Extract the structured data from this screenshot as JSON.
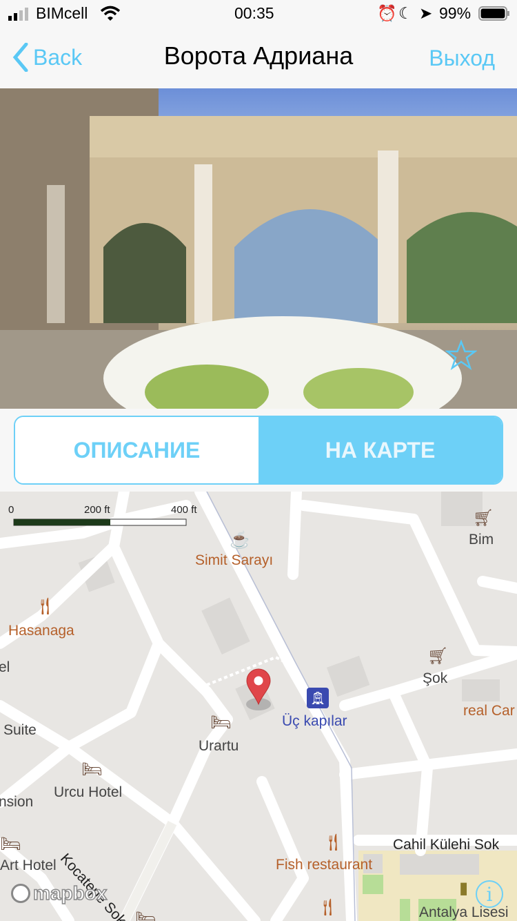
{
  "status": {
    "carrier": "BIMcell",
    "time": "00:35",
    "battery": "99%"
  },
  "nav": {
    "back": "Back",
    "title": "Ворота Адриана",
    "exit": "Выход"
  },
  "tabs": [
    {
      "label": "ОПИСАНИЕ",
      "active": false
    },
    {
      "label": "НА КАРТЕ",
      "active": true
    }
  ],
  "colors": {
    "accent": "#6dd0f7",
    "link": "#5ac8f5",
    "pin": "#e0464a"
  },
  "map": {
    "scale": [
      "0",
      "200 ft",
      "400 ft"
    ],
    "labels": [
      "Simit Sarayı",
      "Bim",
      "Hasanaga",
      "el",
      "Şok",
      "real Car",
      "Suite",
      "Üç kapılar",
      "Urartu",
      "Urcu Hotel",
      "nsion",
      "Kocatepe Sokak",
      "Art Hotel",
      "Fish restaurant",
      "Cahil Külehi Sok",
      "Antalya Lisesi"
    ],
    "attribution": "mapbox",
    "info": "i"
  }
}
